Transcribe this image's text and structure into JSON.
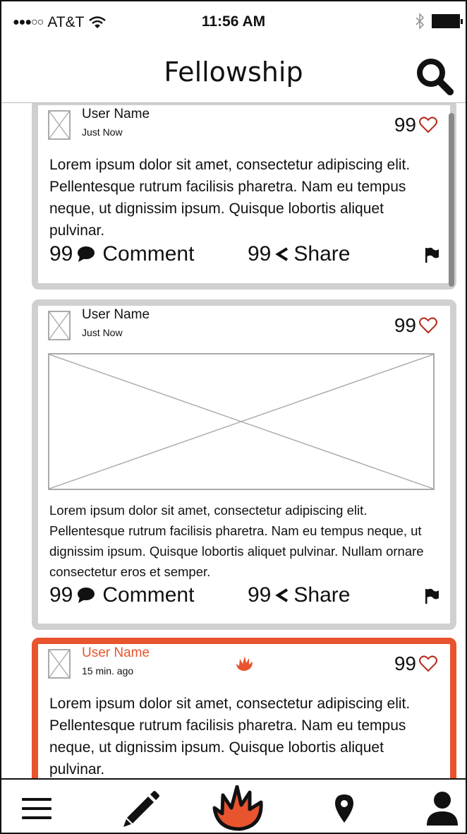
{
  "status_bar": {
    "signal_dots": "●●●○○",
    "carrier": "AT&T",
    "wifi_icon": "wifi-icon",
    "time": "11:56 AM",
    "bluetooth_icon": "bluetooth-icon",
    "battery_icon": "battery-icon"
  },
  "nav": {
    "title": "Fellowship",
    "search_icon": "search-icon"
  },
  "colors": {
    "accent": "#e8542e",
    "heart": "#b52a1c",
    "card_border": "#d0d0d0",
    "placeholder": "#aaaaaa"
  },
  "posts": [
    {
      "user_name": "User Name",
      "time": "Just Now",
      "likes": "99",
      "text": "Lorem ipsum dolor sit amet, consectetur adipiscing elit. Pellentesque rutrum facilisis pharetra. Nam eu tempus neque, ut dignissim ipsum. Quisque lobortis aliquet pulvinar.",
      "comment_count": "99",
      "comment_label": "Comment",
      "share_count": "99",
      "share_label": "Share",
      "hot": false
    },
    {
      "user_name": "User Name",
      "time": "Just Now",
      "likes": "99",
      "has_image": true,
      "text": "Lorem ipsum dolor sit amet, consectetur adipiscing elit. Pellentesque rutrum facilisis pharetra. Nam eu tempus neque, ut dignissim ipsum. Quisque lobortis aliquet pulvinar. Nullam ornare consectetur eros et semper.",
      "comment_count": "99",
      "comment_label": "Comment",
      "share_count": "99",
      "share_label": "Share",
      "hot": false
    },
    {
      "user_name": "User Name",
      "time": "15 min. ago",
      "likes": "99",
      "text": "Lorem ipsum dolor sit amet, consectetur adipiscing elit. Pellentesque rutrum facilisis pharetra. Nam eu tempus neque, ut dignissim ipsum. Quisque lobortis aliquet pulvinar.",
      "hot": true,
      "hot_icon": "flame-icon"
    }
  ],
  "tab_bar": [
    {
      "icon": "menu-icon"
    },
    {
      "icon": "pencil-icon"
    },
    {
      "icon": "flame-icon"
    },
    {
      "icon": "location-pin-icon"
    },
    {
      "icon": "profile-icon"
    }
  ]
}
